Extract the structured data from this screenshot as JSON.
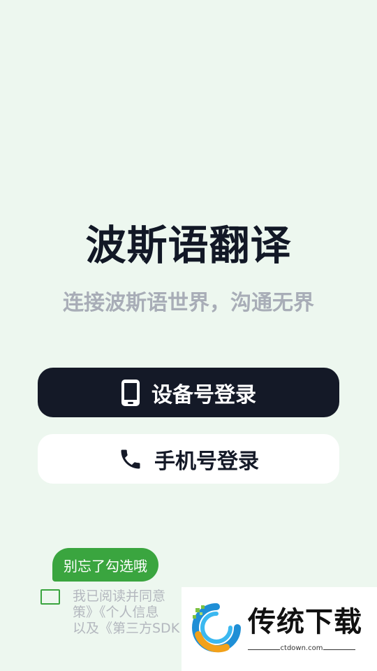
{
  "app": {
    "title": "波斯语翻译",
    "subtitle": "连接波斯语世界，沟通无界"
  },
  "buttons": {
    "device_login": {
      "label": "设备号登录",
      "icon": "smartphone-icon"
    },
    "phone_login": {
      "label": "手机号登录",
      "icon": "phone-handset-icon"
    }
  },
  "tooltip": {
    "text": "别忘了勾选哦"
  },
  "agreement": {
    "checked": false,
    "lines": [
      "我已阅读并同意",
      "策》《个人信息",
      "以及《第三方SDK"
    ]
  },
  "watermark": {
    "brand": "传统下载",
    "url": "ctdown.com"
  },
  "colors": {
    "background": "#edf7ef",
    "primary_dark": "#141927",
    "accent_green": "#3aa53f",
    "muted_text": "#a8adb7"
  }
}
